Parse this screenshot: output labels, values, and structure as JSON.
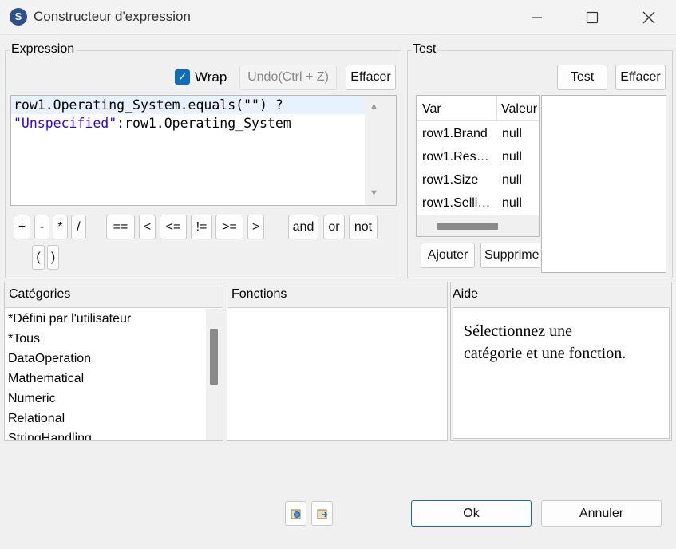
{
  "window": {
    "title": "Constructeur d'expression",
    "icon": "talend-app-icon",
    "controls": [
      "minimize-icon",
      "maximize-icon",
      "close-icon"
    ]
  },
  "expression": {
    "group_label": "Expression",
    "wrap_label": "Wrap",
    "wrap_checked": true,
    "undo_label": "Undo(Ctrl + Z)",
    "clear_label": "Effacer",
    "code_line1": "row1.Operating_System.equals(\"\") ?",
    "code_line2_string": "\"Unspecified\"",
    "code_line2_rest": ":row1.Operating_System",
    "string_color": "#2a00ff",
    "operators": {
      "plus": "+",
      "minus": "-",
      "mul": "*",
      "div": "/",
      "eq": "==",
      "lt": "<",
      "le": "<=",
      "ne": "!=",
      "ge": ">=",
      "gt": ">",
      "and": "and",
      "or": "or",
      "not": "not",
      "lparen": "(",
      "rparen": ")"
    }
  },
  "test": {
    "group_label": "Test",
    "test_label": "Test",
    "clear_label": "Effacer",
    "col_var": "Var",
    "col_value": "Valeur",
    "rows": [
      {
        "var": "row1.Brand",
        "value": "null"
      },
      {
        "var": "row1.Res…",
        "value": "null"
      },
      {
        "var": "row1.Size",
        "value": "null"
      },
      {
        "var": "row1.Selli…",
        "value": "null"
      }
    ],
    "add_label": "Ajouter",
    "remove_label": "Supprimer"
  },
  "categories": {
    "header": "Catégories",
    "items": [
      "*Défini par l'utilisateur",
      "*Tous",
      "DataOperation",
      "Mathematical",
      "Numeric",
      "Relational",
      "StringHandling"
    ]
  },
  "functions": {
    "header": "Fonctions"
  },
  "help": {
    "header": "Aide",
    "text_line1": "Sélectionnez une",
    "text_line2": "catégorie et une fonction."
  },
  "footer": {
    "ok_label": "Ok",
    "cancel_label": "Annuler",
    "import_icon": "import-expression-icon",
    "export_icon": "export-expression-icon"
  }
}
